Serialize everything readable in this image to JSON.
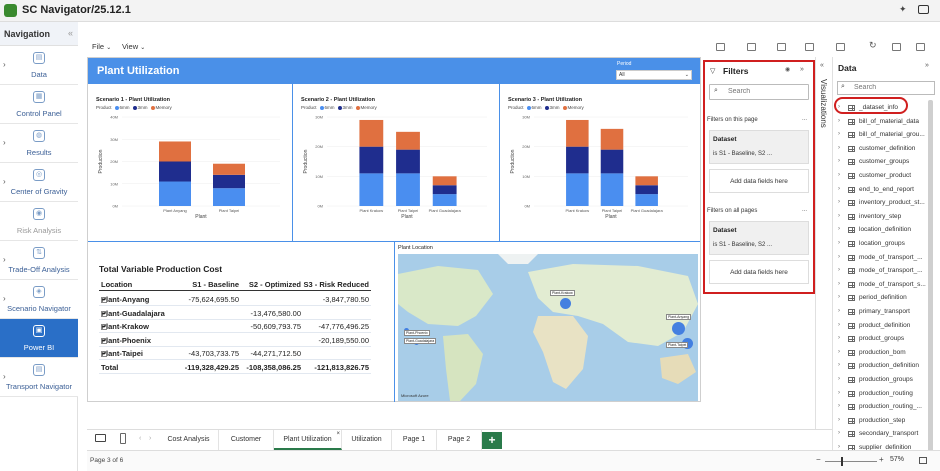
{
  "window": {
    "title": "SC Navigator/25.12.1"
  },
  "nav": {
    "title": "Navigation",
    "items": [
      {
        "label": "Data",
        "icon": "database-icon",
        "glyph": "▤",
        "chevron": true,
        "active": false,
        "disabled": false
      },
      {
        "label": "Control Panel",
        "icon": "control-panel-icon",
        "glyph": "▦",
        "chevron": false,
        "active": false,
        "disabled": false
      },
      {
        "label": "Results",
        "icon": "results-icon",
        "glyph": "◍",
        "chevron": true,
        "active": false,
        "disabled": false
      },
      {
        "label": "Center of Gravity",
        "icon": "center-of-gravity-icon",
        "glyph": "◎",
        "chevron": true,
        "active": false,
        "disabled": false
      },
      {
        "label": "Risk Analysis",
        "icon": "risk-analysis-icon",
        "glyph": "◉",
        "chevron": false,
        "active": false,
        "disabled": true
      },
      {
        "label": "Trade-Off Analysis",
        "icon": "trade-off-icon",
        "glyph": "⇅",
        "chevron": true,
        "active": false,
        "disabled": false
      },
      {
        "label": "Scenario Navigator",
        "icon": "scenario-navigator-icon",
        "glyph": "◈",
        "chevron": true,
        "active": false,
        "disabled": false
      },
      {
        "label": "Power BI",
        "icon": "power-bi-icon",
        "glyph": "▣",
        "chevron": false,
        "active": true,
        "disabled": false
      },
      {
        "label": "Transport Navigator",
        "icon": "transport-navigator-icon",
        "glyph": "▤",
        "chevron": true,
        "active": false,
        "disabled": false
      }
    ]
  },
  "menu": {
    "file": "File",
    "view": "View"
  },
  "report": {
    "title": "Plant Utilization",
    "period": {
      "label": "Period",
      "value": "All"
    }
  },
  "chart_data": [
    {
      "type": "bar",
      "stacked": true,
      "title": "Scenario 1 - Plant Utilization",
      "xlabel": "Plant",
      "ylabel": "Production",
      "legend_title": "Product",
      "legend_position": "top-left",
      "categories": [
        "Plant Anyang",
        "Plant Taipei"
      ],
      "series": [
        {
          "name": "6mm",
          "color": "#4a8ef0",
          "values": [
            11,
            8
          ]
        },
        {
          "name": "3mm",
          "color": "#1f2d8e",
          "values": [
            9,
            6
          ]
        },
        {
          "name": "Memory",
          "color": "#e07040",
          "values": [
            9,
            5
          ]
        }
      ],
      "ylim": [
        0,
        40
      ],
      "yticks": [
        0,
        10,
        20,
        30,
        40
      ],
      "ytick_labels": [
        "0M",
        "10M",
        "20M",
        "30M",
        "40M"
      ]
    },
    {
      "type": "bar",
      "stacked": true,
      "title": "Scenario 2 - Plant Utilization",
      "xlabel": "Plant",
      "ylabel": "Production",
      "legend_title": "Product",
      "legend_position": "top-left",
      "categories": [
        "Plant Krakow",
        "Plant Taipei",
        "Plant Guadalajara"
      ],
      "series": [
        {
          "name": "6mm",
          "color": "#4a8ef0",
          "values": [
            11,
            11,
            4
          ]
        },
        {
          "name": "3mm",
          "color": "#1f2d8e",
          "values": [
            9,
            8,
            3
          ]
        },
        {
          "name": "Memory",
          "color": "#e07040",
          "values": [
            9,
            6,
            3
          ]
        }
      ],
      "ylim": [
        0,
        30
      ],
      "yticks": [
        0,
        10,
        20,
        30
      ],
      "ytick_labels": [
        "0M",
        "10M",
        "20M",
        "30M"
      ]
    },
    {
      "type": "bar",
      "stacked": true,
      "title": "Scenario 3 - Plant Utilization",
      "xlabel": "Plant",
      "ylabel": "Production",
      "legend_title": "Product",
      "legend_position": "top-left",
      "categories": [
        "Plant Krakow",
        "Plant Taipei",
        "Plant Guadalajara"
      ],
      "series": [
        {
          "name": "6mm",
          "color": "#4a8ef0",
          "values": [
            11,
            11,
            4
          ]
        },
        {
          "name": "3mm",
          "color": "#1f2d8e",
          "values": [
            9,
            8,
            3
          ]
        },
        {
          "name": "Memory",
          "color": "#e07040",
          "values": [
            9,
            7,
            3
          ]
        }
      ],
      "ylim": [
        0,
        30
      ],
      "yticks": [
        0,
        10,
        20,
        30
      ],
      "ytick_labels": [
        "0M",
        "10M",
        "20M",
        "30M"
      ]
    }
  ],
  "cost_table": {
    "title": "Total Variable Production Cost",
    "headers": [
      "Location",
      "S1 - Baseline",
      "S2 - Optimized",
      "S3 - Risk Reduced"
    ],
    "rows": [
      [
        "Plant-Anyang",
        "-75,624,695.50",
        "",
        "-3,847,780.50"
      ],
      [
        "Plant-Guadalajara",
        "",
        "-13,476,580.00",
        ""
      ],
      [
        "Plant-Krakow",
        "",
        "-50,609,793.75",
        "-47,776,496.25"
      ],
      [
        "Plant-Phoenix",
        "",
        "",
        "-20,189,550.00"
      ],
      [
        "Plant-Taipei",
        "-43,703,733.75",
        "-44,271,712.50",
        ""
      ]
    ],
    "total": [
      "Total",
      "-119,328,429.25",
      "-108,358,086.25",
      "-121,813,826.75"
    ]
  },
  "map": {
    "title": "Plant Location",
    "labels": [
      "Plant-Krakow",
      "Plant-Phoenix",
      "Plant-Guadalajara",
      "Plant-Anyang",
      "Plant-Taipei"
    ],
    "attribution": "Microsoft Azure"
  },
  "filters": {
    "title": "Filters",
    "search_placeholder": "Search",
    "on_page_label": "Filters on this page",
    "all_pages_label": "Filters on all pages",
    "more": "...",
    "cards": [
      {
        "title": "Dataset",
        "value": "is S1 - Baseline, S2 ..."
      },
      {
        "title": "Dataset",
        "value": "is S1 - Baseline, S2 ..."
      }
    ],
    "add_label": "Add data fields here"
  },
  "visualizations": {
    "label": "Visualizations"
  },
  "data_pane": {
    "title": "Data",
    "search_placeholder": "Search",
    "tables": [
      "_dataset_info",
      "bill_of_material_data",
      "bill_of_material_grou...",
      "customer_definition",
      "customer_groups",
      "customer_product",
      "end_to_end_report",
      "inventory_product_st...",
      "inventory_step",
      "location_definition",
      "location_groups",
      "mode_of_transport_...",
      "mode_of_transport_...",
      "mode_of_transport_s...",
      "period_definition",
      "primary_transport",
      "product_definition",
      "product_groups",
      "production_bom",
      "production_definition",
      "production_groups",
      "production_routing",
      "production_routing_...",
      "production_step",
      "secondary_transport",
      "supplier_definition"
    ]
  },
  "tabs": {
    "items": [
      "Cost Analysis",
      "Customer",
      "Plant Utilization",
      "Utilization",
      "Page 1",
      "Page 2"
    ],
    "active": "Plant Utilization",
    "add": "+"
  },
  "status": {
    "page": "Page 3 of 6",
    "zoom": "57%",
    "zoom_fraction": 0.3
  }
}
